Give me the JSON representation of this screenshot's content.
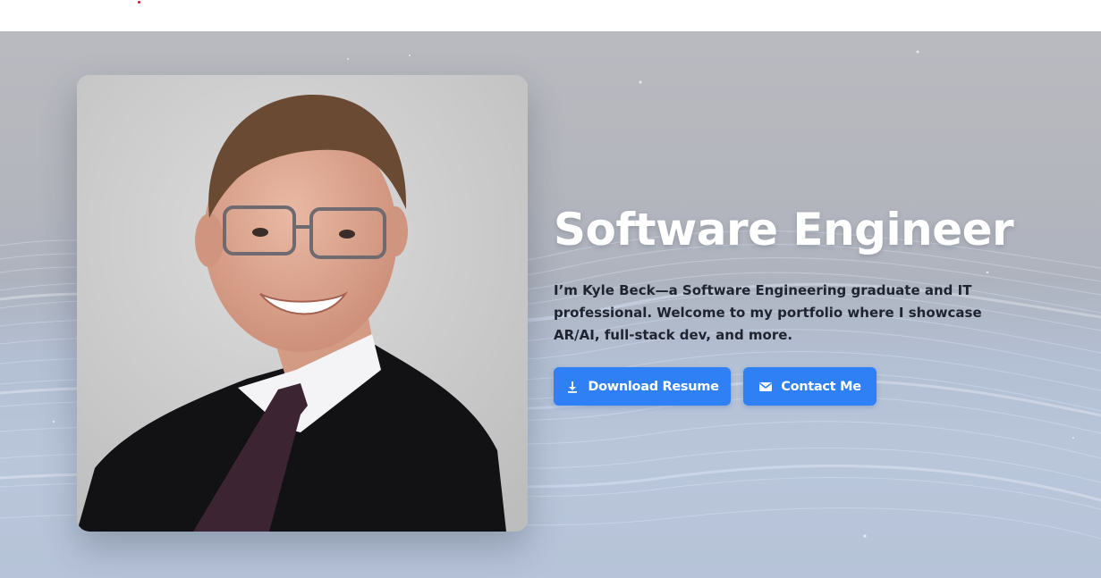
{
  "header": {
    "accent_color": "#d11a2a"
  },
  "hero": {
    "photo_alt": "Kyle Beck portrait",
    "title": "Software Engineer",
    "intro": "I’m Kyle Beck—a Software Engineering graduate and IT professional. Welcome to my portfolio where I showcase AR/AI, full-stack dev, and more.",
    "buttons": {
      "download_label": "Download Resume",
      "download_icon": "download-icon",
      "contact_label": "Contact Me",
      "contact_icon": "mail-icon"
    },
    "accent_color": "#2f7ff5"
  }
}
